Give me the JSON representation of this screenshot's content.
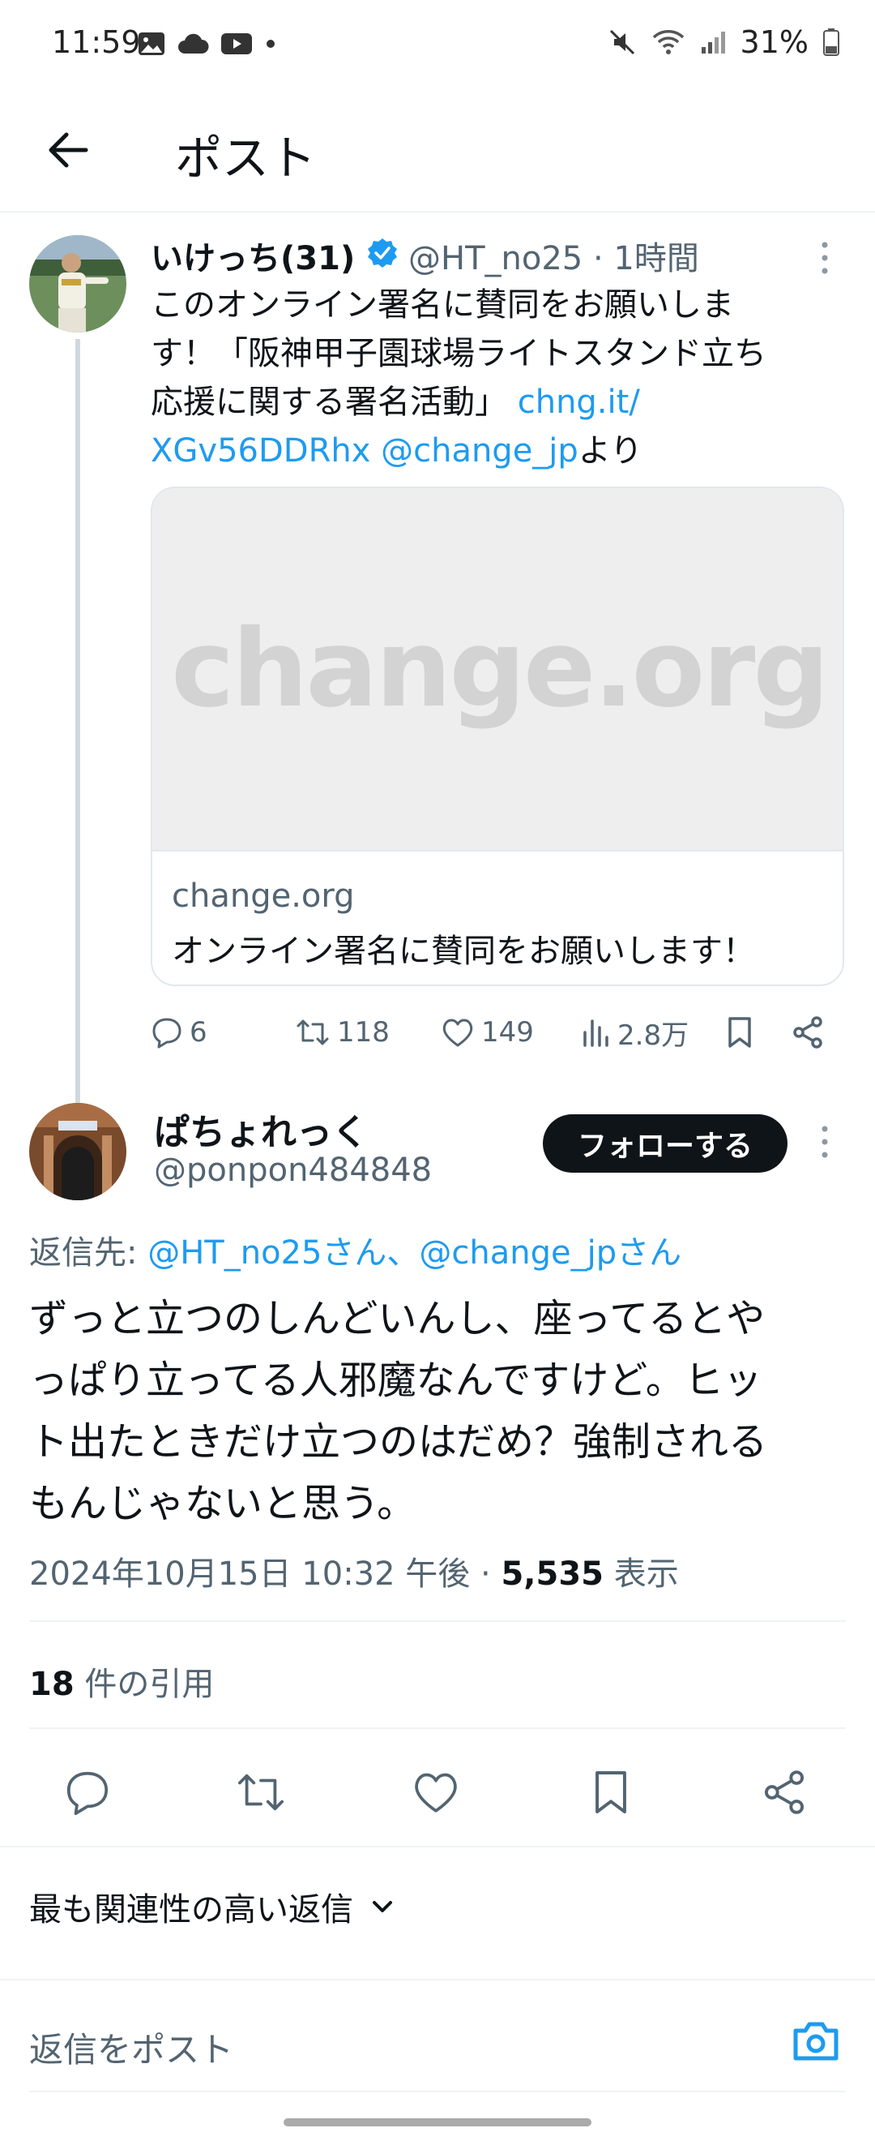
{
  "status_bar": {
    "time": "11:59",
    "battery": "31%"
  },
  "header": {
    "title": "ポスト"
  },
  "parent_post": {
    "name": "いけっち(31)",
    "handle_time": "@HT_no25 · 1時間",
    "text_lines": [
      "このオンライン署名に賛同をお願いしま",
      "す！「阪神甲子園球場ライトスタンド立ち",
      "応援に関する署名活動」 ",
      "chng.it/",
      "XGv56DDRhx @change_jp",
      "より"
    ],
    "card": {
      "logo_text": "change.org",
      "domain": "change.org",
      "title": "オンライン署名に賛同をお願いします！"
    },
    "stats": {
      "replies": "6",
      "reposts": "118",
      "likes": "149",
      "views": "2.8万"
    }
  },
  "reply_post": {
    "name": "ぱちょれっく",
    "handle": "@ponpon484848",
    "follow_label": "フォローする",
    "reply_to_prefix": "返信先: ",
    "reply_to_users": "@HT_no25さん、@change_jpさん",
    "text_lines": [
      "ずっと立つのしんどいんし、座ってるとや",
      "っぱり立ってる人邪魔なんですけど。ヒッ",
      "ト出たときだけ立つのはだめ？強制される",
      "もんじゃないと思う。"
    ],
    "timestamp": "2024年10月15日 10:32 午後 · ",
    "views_count": "5,535",
    "views_label": " 表示",
    "quotes_count": "18",
    "quotes_label": " 件の引用"
  },
  "sort": {
    "label": "最も関連性の高い返信"
  },
  "composer": {
    "placeholder": "返信をポスト"
  },
  "colors": {
    "accent": "#1d9bf0",
    "text": "#0f1419",
    "muted": "#536471"
  }
}
